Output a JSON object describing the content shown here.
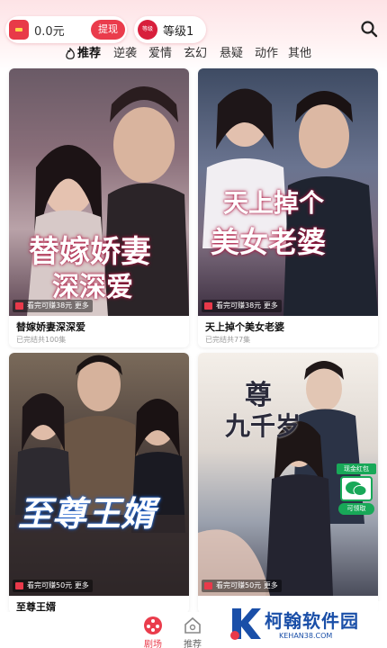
{
  "header": {
    "balance": "0.0元",
    "withdraw_label": "提现",
    "level_badge": "等级",
    "level_label": "等级1"
  },
  "tabs": [
    {
      "label": "推荐",
      "active": true
    },
    {
      "label": "逆袭",
      "active": false
    },
    {
      "label": "爱情",
      "active": false
    },
    {
      "label": "玄幻",
      "active": false
    },
    {
      "label": "悬疑",
      "active": false
    },
    {
      "label": "动作",
      "active": false
    },
    {
      "label": "其他",
      "active": false
    }
  ],
  "cards": [
    {
      "title": "替嫁娇妻深深爱",
      "status": "已完结共100集",
      "poster_title_1": "替嫁娇妻",
      "poster_title_2": "深深爱",
      "tag": "看完可赚38元 ",
      "tag_more": "更多"
    },
    {
      "title": "天上掉个美女老婆",
      "status": "已完结共77集",
      "poster_title_1": "天上掉个",
      "poster_title_2": "美女老婆",
      "tag": "看完可赚38元 ",
      "tag_more": "更多"
    },
    {
      "title": "至尊王婿",
      "status": "",
      "poster_title_1": "至尊王婿",
      "poster_title_2": "",
      "tag": "看完可赚50元 ",
      "tag_more": "更多"
    },
    {
      "title": "",
      "status": "",
      "poster_title_1": "尊",
      "poster_title_2": "九千岁",
      "tag": "看完可赚50元 ",
      "tag_more": "更多"
    }
  ],
  "red_packet": {
    "label": "现金红包",
    "claim": "可领取"
  },
  "bottom_nav": [
    {
      "label": "剧场",
      "active": true,
      "icon": "theater-icon"
    },
    {
      "label": "推荐",
      "active": false,
      "icon": "home-icon"
    }
  ],
  "watermark": {
    "name": "柯翰软件园",
    "url": "KEHAN38.COM"
  },
  "colors": {
    "accent": "#ea3c4c",
    "green": "#18a858",
    "watermark_blue": "#1a4fa8"
  }
}
